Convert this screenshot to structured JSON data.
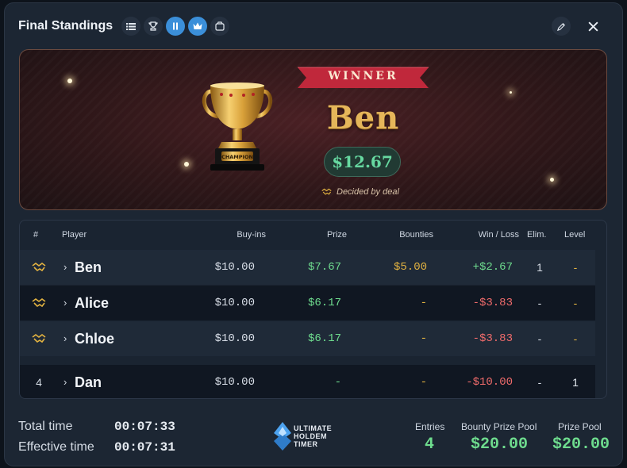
{
  "window": {
    "title": "Final Standings"
  },
  "toolbar": {
    "icons": [
      "list-icon",
      "trophy-icon",
      "pause-icon",
      "crown-icon",
      "box-icon",
      "edit-icon",
      "close-icon"
    ]
  },
  "banner": {
    "ribbon": "WINNER",
    "winner_name": "Ben",
    "prize": "$12.67",
    "deal_note": "Decided by deal",
    "trophy_plate": "CHAMPION"
  },
  "table": {
    "headers": {
      "rank": "#",
      "player": "Player",
      "buyins": "Buy-ins",
      "prize": "Prize",
      "bounties": "Bounties",
      "winloss": "Win / Loss",
      "elim": "Elim.",
      "level": "Level"
    },
    "rows": [
      {
        "rank": "",
        "rank_icon": "handshake-icon",
        "player": "Ben",
        "buyins": "$10.00",
        "prize": "$7.67",
        "bounties": "$5.00",
        "winloss": "+$2.67",
        "elim": "1",
        "level": "-"
      },
      {
        "rank": "",
        "rank_icon": "handshake-icon",
        "player": "Alice",
        "buyins": "$10.00",
        "prize": "$6.17",
        "bounties": "-",
        "winloss": "-$3.83",
        "elim": "-",
        "level": "-"
      },
      {
        "rank": "",
        "rank_icon": "handshake-icon",
        "player": "Chloe",
        "buyins": "$10.00",
        "prize": "$6.17",
        "bounties": "-",
        "winloss": "-$3.83",
        "elim": "-",
        "level": "-"
      },
      {
        "rank": "4",
        "rank_icon": "",
        "player": "Dan",
        "buyins": "$10.00",
        "prize": "-",
        "bounties": "-",
        "winloss": "-$10.00",
        "elim": "-",
        "level": "1"
      }
    ]
  },
  "footer": {
    "total_time_label": "Total time",
    "total_time": "00:07:33",
    "effective_time_label": "Effective time",
    "effective_time": "00:07:31",
    "logo_lines": [
      "ULTIMATE",
      "HOLDEM",
      "TIMER"
    ],
    "entries_label": "Entries",
    "entries": "4",
    "bounty_pool_label": "Bounty Prize Pool",
    "bounty_pool": "$20.00",
    "prize_pool_label": "Prize Pool",
    "prize_pool": "$20.00"
  },
  "colors": {
    "accent": "#3b8fd9",
    "positive": "#6edc8e",
    "negative": "#ef6b6b",
    "bounty": "#e3b341",
    "gold": "#e5b65a"
  }
}
